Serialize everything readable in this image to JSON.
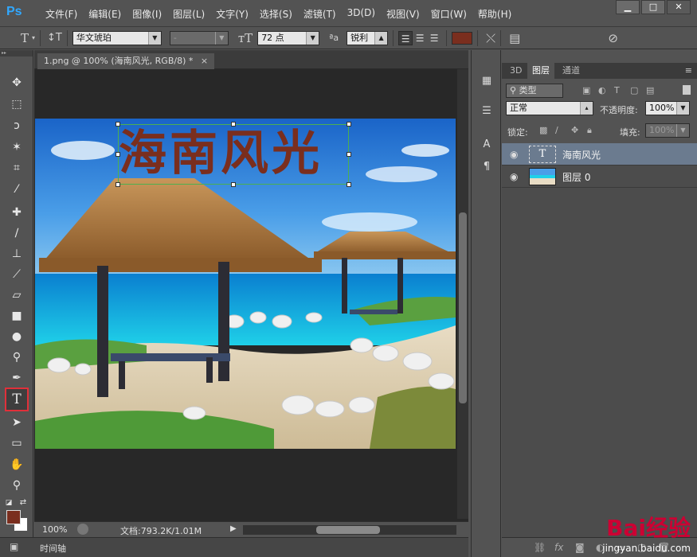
{
  "app": {
    "logo": "Ps"
  },
  "menu": [
    "文件(F)",
    "编辑(E)",
    "图像(I)",
    "图层(L)",
    "文字(Y)",
    "选择(S)",
    "滤镜(T)",
    "3D(D)",
    "视图(V)",
    "窗口(W)",
    "帮助(H)"
  ],
  "window_controls": {
    "minimize": "▁",
    "maximize": "□",
    "close": "✕"
  },
  "options": {
    "font_family": "华文琥珀",
    "font_style": "-",
    "font_size": "72 点",
    "aa_label": "ªa",
    "antialias": "锐利",
    "text_color": "#7a2e1e"
  },
  "document": {
    "tab_title": "1.png @ 100% (海南风光, RGB/8) *",
    "close": "×",
    "headline": "海南风光"
  },
  "status": {
    "zoom": "100%",
    "doc_info": "文档:793.2K/1.01M"
  },
  "timeline": {
    "label": "时间轴"
  },
  "layers_panel": {
    "tabs": [
      "3D",
      "图层",
      "通道"
    ],
    "active_tab": "图层",
    "filter_kind": "类型",
    "blend_mode": "正常",
    "opacity_label": "不透明度:",
    "opacity_value": "100%",
    "lock_label": "锁定:",
    "fill_label": "填充:",
    "fill_value": "100%",
    "layers": [
      {
        "name": "海南风光",
        "kind": "text",
        "selected": true
      },
      {
        "name": "图层 0",
        "kind": "image",
        "selected": false
      }
    ]
  },
  "colors": {
    "foreground": "#7a2e1e",
    "background": "#ffffff",
    "highlight": "#e0303a"
  },
  "watermark": {
    "brand": "Bai经验",
    "url": "jingyan.baidu.com"
  }
}
